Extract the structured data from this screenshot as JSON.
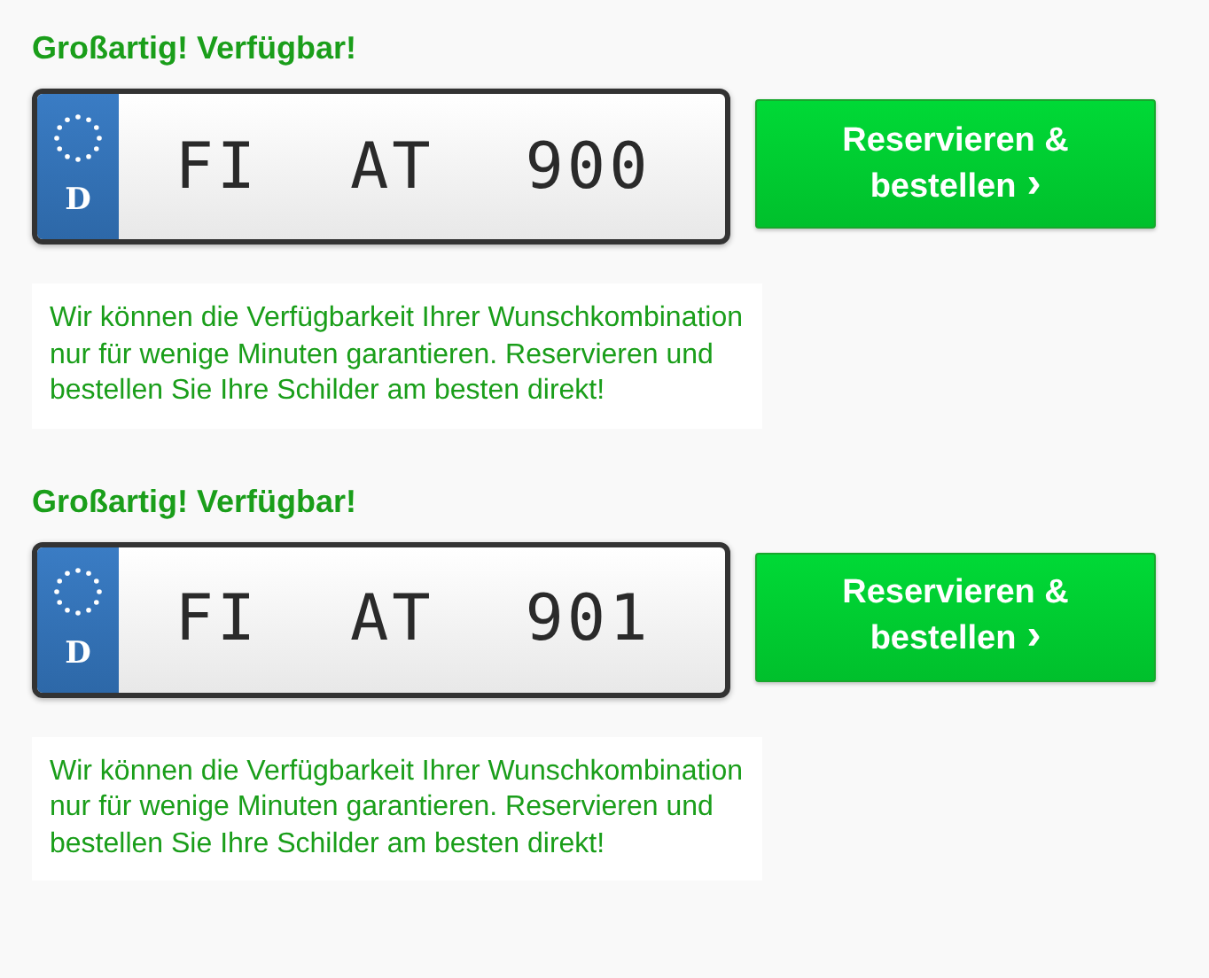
{
  "results": [
    {
      "heading": "Großartig! Verfügbar!",
      "plate": {
        "country": "D",
        "parts": [
          "FI",
          "AT",
          "900"
        ]
      },
      "button": {
        "label": "Reservieren & bestellen",
        "arrow": "›"
      },
      "note": "Wir können die Verfügbarkeit Ihrer Wunschkombination nur für wenige Minuten garantieren. Reservieren und bestellen Sie Ihre Schilder am besten direkt!"
    },
    {
      "heading": "Großartig! Verfügbar!",
      "plate": {
        "country": "D",
        "parts": [
          "FI",
          "AT",
          "901"
        ]
      },
      "button": {
        "label": "Reservieren & bestellen",
        "arrow": "›"
      },
      "note": "Wir können die Verfügbarkeit Ihrer Wunschkombination nur für wenige Minuten garantieren. Reservieren und bestellen Sie Ihre Schilder am besten direkt!"
    }
  ]
}
